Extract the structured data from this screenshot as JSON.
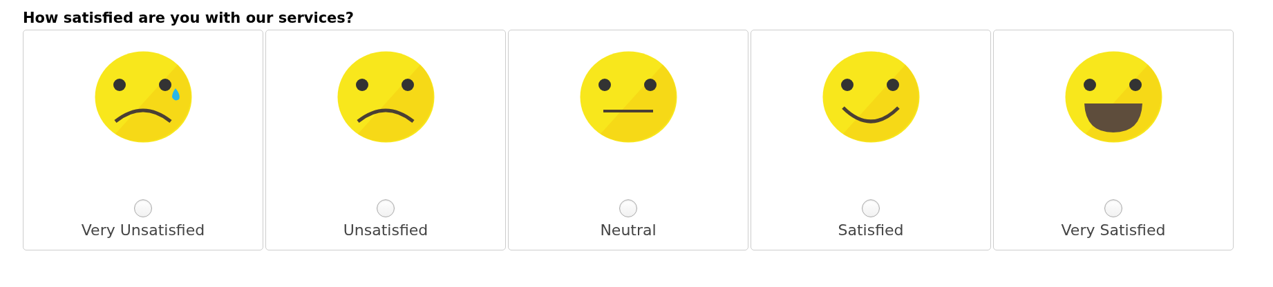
{
  "question": "How satisfied are you with our services?",
  "options": [
    {
      "label": "Very Unsatisfied",
      "kind": "crying",
      "selected": false
    },
    {
      "label": "Unsatisfied",
      "kind": "sad",
      "selected": false
    },
    {
      "label": "Neutral",
      "kind": "neutral",
      "selected": false
    },
    {
      "label": "Satisfied",
      "kind": "smile",
      "selected": false
    },
    {
      "label": "Very Satisfied",
      "kind": "grin",
      "selected": false
    }
  ]
}
